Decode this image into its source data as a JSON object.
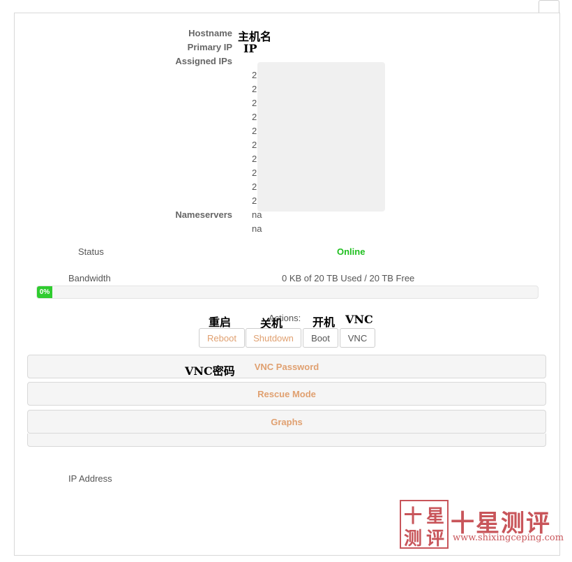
{
  "details": {
    "hostname_label": "Hostname",
    "primary_ip_label": "Primary IP",
    "assigned_ips_label": "Assigned IPs",
    "nameservers_label": "Nameservers",
    "assigned_ips": [
      "2",
      "2",
      "2",
      "2",
      "2",
      "2",
      "2",
      "2",
      "2",
      "2"
    ],
    "nameservers": [
      "na",
      "na"
    ]
  },
  "annotations": {
    "hostname": "主机名",
    "primary_ip": "IP",
    "reboot": "重启",
    "shutdown": "关机",
    "boot": "开机",
    "vnc": "VNC",
    "vnc_password": "VNC密码"
  },
  "status": {
    "label": "Status",
    "value": "Online",
    "color": "#1fbf1f"
  },
  "bandwidth": {
    "label": "Bandwidth",
    "summary": "0 KB of 20 TB Used / 20 TB Free",
    "percent_label": "0%",
    "used_fraction": 0
  },
  "actions": {
    "label": "Actions:",
    "reboot": "Reboot",
    "shutdown": "Shutdown",
    "boot": "Boot",
    "vnc": "VNC"
  },
  "sections": {
    "vnc_password": "VNC Password",
    "rescue_mode": "Rescue Mode",
    "graphs": "Graphs"
  },
  "ip_address_label": "IP Address",
  "watermark": {
    "logo_chars": [
      "十",
      "星",
      "测",
      "评"
    ],
    "title": "十星测评",
    "url": "www.shixingceping.com"
  },
  "colors": {
    "accent": "#e0a070",
    "online": "#1fbf1f",
    "progress": "#2fcc2f",
    "watermark": "#c8555a"
  }
}
